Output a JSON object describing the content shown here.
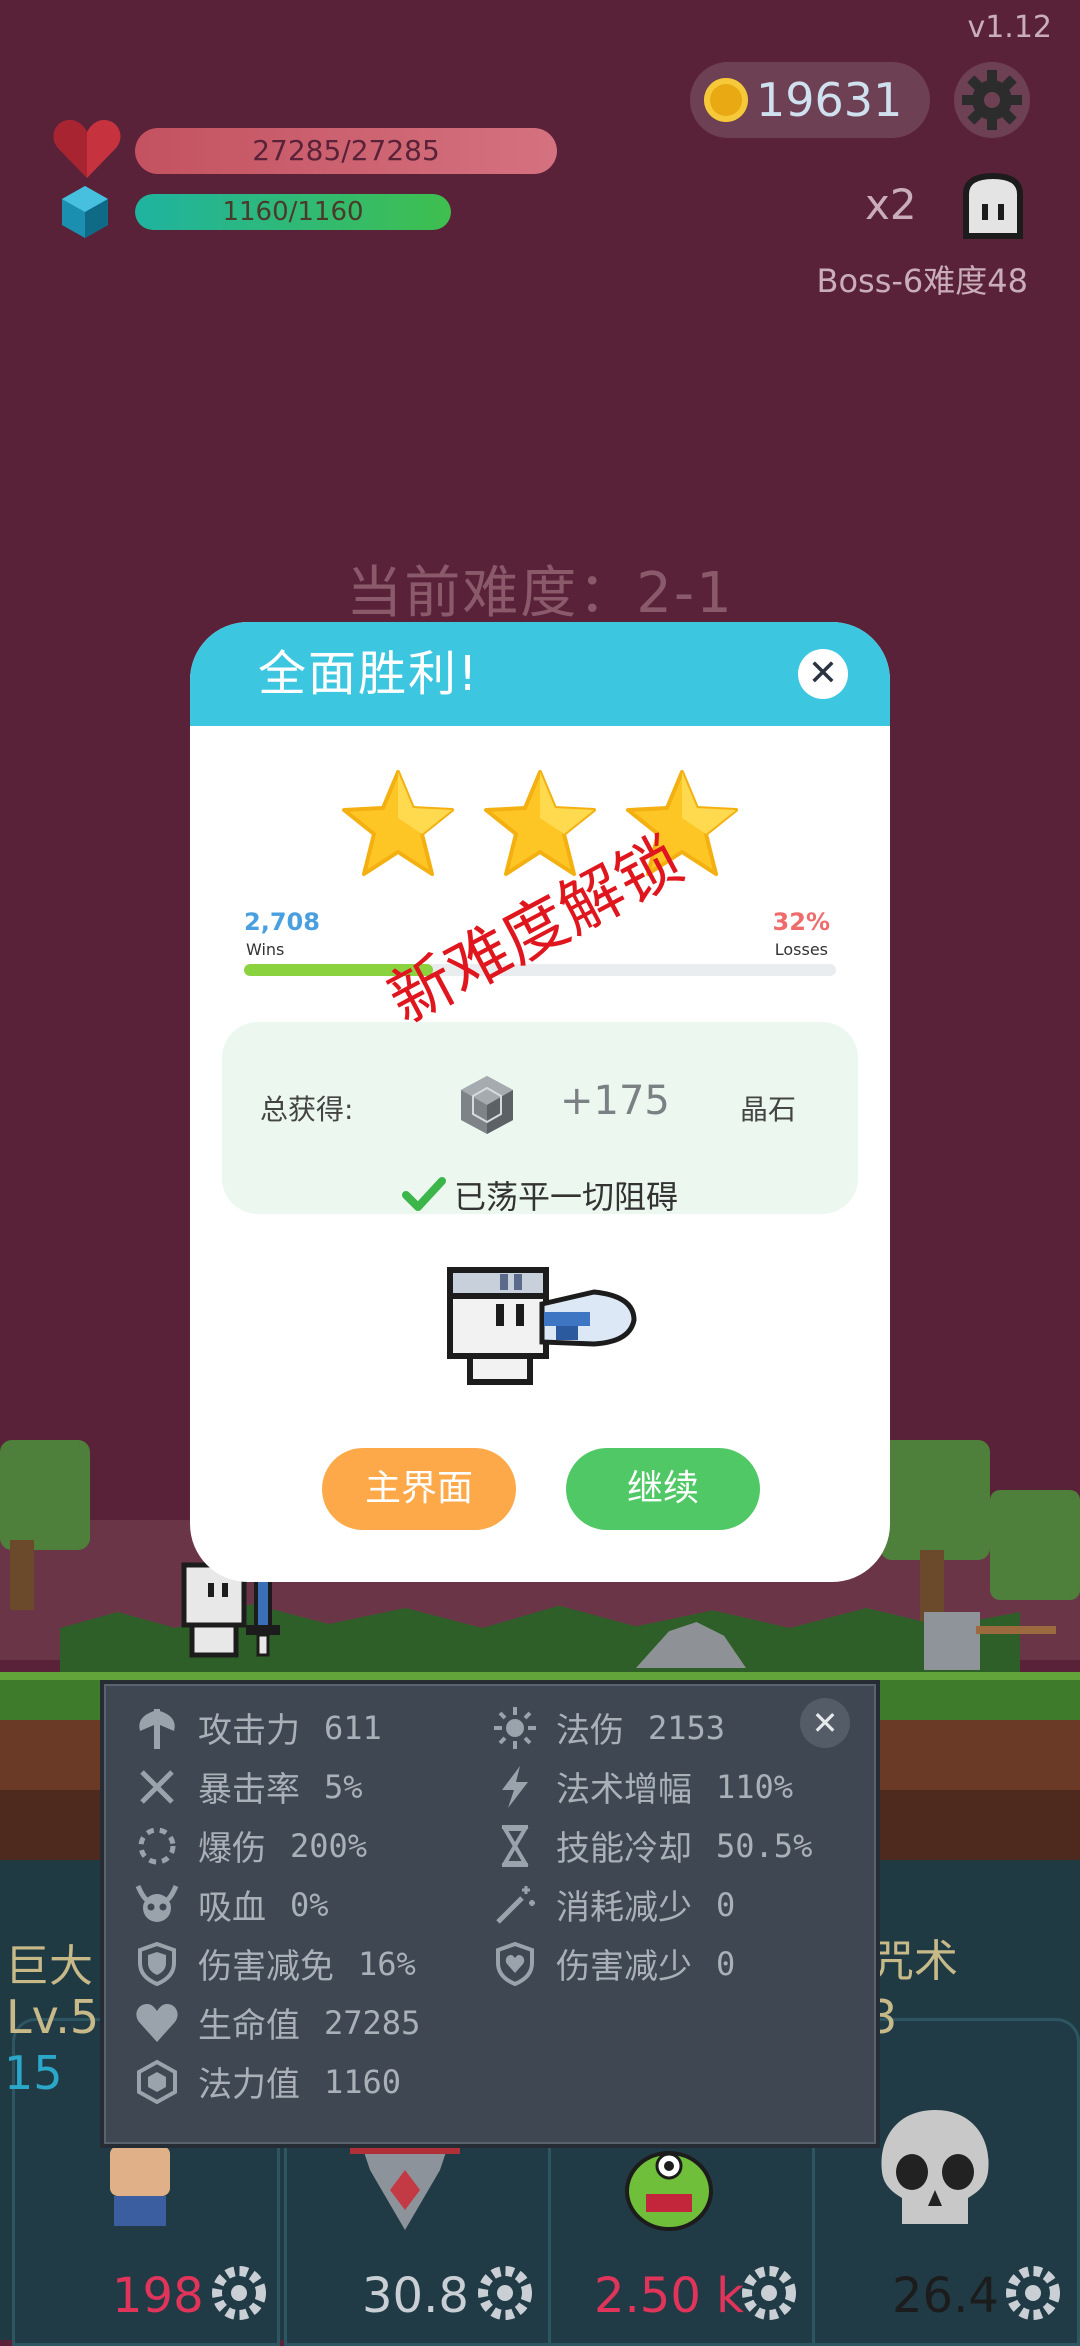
{
  "version": "v1.12",
  "hud": {
    "hp_text": "27285/27285",
    "hp_fraction": 1.0,
    "mp_text": "1160/1160",
    "mp_fraction": 1.0,
    "coins": "19631",
    "speed": "x2",
    "boss_label": "Boss-6难度48",
    "icons": [
      "heart-icon",
      "mana-gem-icon",
      "coin-icon",
      "gear-icon",
      "ghost-icon"
    ]
  },
  "current_difficulty": "当前难度：2-1",
  "modal": {
    "title": "全面胜利!",
    "close": "✕",
    "stars_earned": 3,
    "stars_total": 3,
    "wins_value": "2,708",
    "wins_label": "Wins",
    "losses_value": "32%",
    "losses_label": "Losses",
    "progress_fraction": 0.32,
    "unlock_stamp": "新难度解锁",
    "reward_label": "总获得:",
    "reward_amount": "+175",
    "reward_unit": "晶石",
    "cleared_text": "已荡平一切阻碍",
    "home_button": "主界面",
    "continue_button": "继续"
  },
  "stats_panel": {
    "close": "✕",
    "left": [
      {
        "icon": "axe-icon",
        "label": "攻击力",
        "value": "611"
      },
      {
        "icon": "crit-icon",
        "label": "暴击率",
        "value": "5%"
      },
      {
        "icon": "burst-icon",
        "label": "爆伤",
        "value": "200%"
      },
      {
        "icon": "horned-skull-icon",
        "label": "吸血",
        "value": "0%"
      },
      {
        "icon": "shield-icon",
        "label": "伤害减免",
        "value": "16%"
      },
      {
        "icon": "heart-icon",
        "label": "生命值",
        "value": "27285"
      },
      {
        "icon": "mana-gem-icon",
        "label": "法力值",
        "value": "1160"
      }
    ],
    "right": [
      {
        "icon": "sun-icon",
        "label": "法伤",
        "value": "2153"
      },
      {
        "icon": "lightning-icon",
        "label": "法术增幅",
        "value": "110%"
      },
      {
        "icon": "hourglass-icon",
        "label": "技能冷却",
        "value": "50.5%"
      },
      {
        "icon": "magic-wand-icon",
        "label": "消耗减少",
        "value": "0"
      },
      {
        "icon": "heart-shield-icon",
        "label": "伤害减少",
        "value": "0"
      }
    ]
  },
  "skills": {
    "left_name": "巨大",
    "left_level": "Lv.5",
    "left_count": "15",
    "right_name": "咒术",
    "right_level": "3",
    "card_values": [
      "198",
      "30.8",
      "2.50 k",
      "26.4"
    ],
    "card_value_colors": [
      "#e0345a",
      "#c9cfd4",
      "#e0345a",
      "#1c1c1c"
    ]
  }
}
